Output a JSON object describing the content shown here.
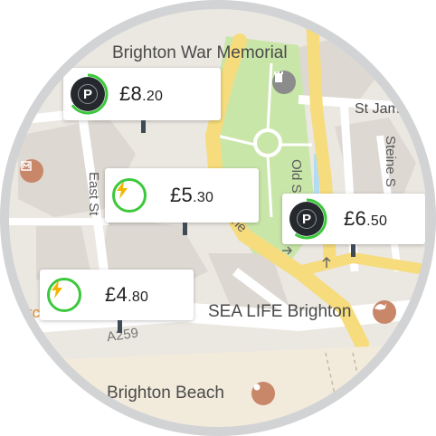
{
  "map": {
    "labels": {
      "war_memorial": "Brighton War Memorial",
      "st_james": "St Jam",
      "old_steine": "Old Ste",
      "steine_st": "Steine S",
      "east_st": "East St",
      "grand_junction": "ne",
      "a259": "A259",
      "sea_life": "SEA LIFE Brighton",
      "brighton_beach": "Brighton Beach",
      "arcade": "rcade"
    },
    "colors": {
      "base": "#ebe7e1",
      "block": "#ddd8d2",
      "park": "#c9e6a9",
      "major_road": "#f6dc7c",
      "road": "#ffffff",
      "ev_green": "#3cc83c",
      "poi_brown": "#c9876a",
      "beach": "#f2ebdc"
    }
  },
  "cards": [
    {
      "kind": "parking",
      "icon": "parking-icon",
      "pounds": "£8",
      "pence": ".20",
      "progress": 0.65
    },
    {
      "kind": "ev",
      "icon": "lightning-icon",
      "pounds": "£5",
      "pence": ".30"
    },
    {
      "kind": "parking",
      "icon": "parking-icon",
      "pounds": "£6",
      "pence": ".50",
      "progress": 0.6
    },
    {
      "kind": "ev",
      "icon": "lightning-icon",
      "pounds": "£4",
      "pence": ".80"
    }
  ]
}
